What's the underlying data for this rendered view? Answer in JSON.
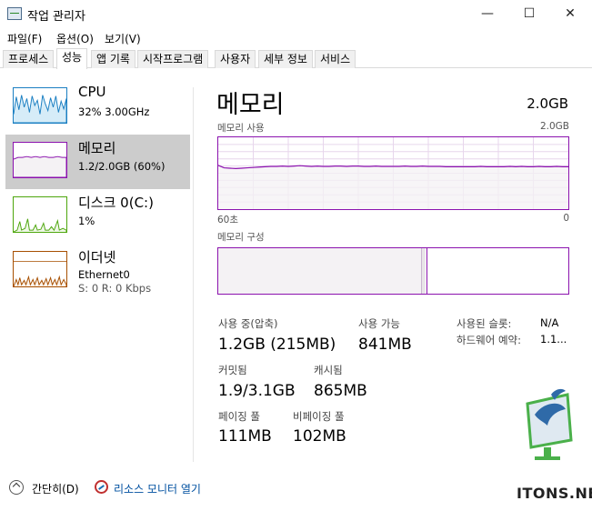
{
  "window": {
    "title": "작업 관리자",
    "controls": {
      "minimize": "—",
      "maximize": "☐",
      "close": "✕"
    }
  },
  "menu": {
    "items": [
      "파일(F)",
      "옵션(O)",
      "보기(V)"
    ]
  },
  "tabs": {
    "items": [
      "프로세스",
      "성능",
      "앱 기록",
      "시작프로그램",
      "사용자",
      "세부 정보",
      "서비스"
    ],
    "active": "성능"
  },
  "sidebar": {
    "items": [
      {
        "name": "CPU",
        "sub1": "32% 3.00GHz",
        "sub2": "",
        "color": "#1b7fc2",
        "fill": "#d6ecf8"
      },
      {
        "name": "메모리",
        "sub1": "1.2/2.0GB (60%)",
        "sub2": "",
        "color": "#8b12ae",
        "fill": "#f4f2f4",
        "selected": true
      },
      {
        "name": "디스크 0(C:)",
        "sub1": "1%",
        "sub2": "",
        "color": "#4da60c",
        "fill": "#eef7e6"
      },
      {
        "name": "이더넷",
        "sub1": "Ethernet0",
        "sub2": "S: 0 R: 0 Kbps",
        "color": "#a74f01",
        "fill": "#fcf3eb"
      }
    ]
  },
  "main": {
    "title": "메모리",
    "total": "2.0GB",
    "graph": {
      "label": "메모리 사용",
      "max_label": "2.0GB",
      "time_left": "60초",
      "time_right": "0",
      "color": "#8b12ae"
    },
    "composition": {
      "label": "메모리 구성",
      "in_use_fraction": 0.58,
      "modified_fraction": 0.012
    },
    "stats": {
      "in_use": {
        "label": "사용 중(압축)",
        "value": "1.2GB (215MB)"
      },
      "available": {
        "label": "사용 가능",
        "value": "841MB"
      },
      "slots": {
        "label": "사용된 슬롯:",
        "value": "N/A"
      },
      "hw_reserved": {
        "label": "하드웨어 예약:",
        "value": "1.1..."
      },
      "committed": {
        "label": "커밋됨",
        "value": "1.9/3.1GB"
      },
      "cached": {
        "label": "캐시됨",
        "value": "865MB"
      },
      "paged_pool": {
        "label": "페이징 풀",
        "value": "111MB"
      },
      "nonpaged_pool": {
        "label": "비페이징 풀",
        "value": "102MB"
      }
    }
  },
  "footer": {
    "collapse": "간단히(D)",
    "resource_monitor": "리소스 모니터 열기"
  },
  "chart_data": {
    "type": "area",
    "title": "메모리 사용",
    "xlabel": "",
    "ylabel": "",
    "x_range": [
      "60초",
      "0"
    ],
    "ylim": [
      0,
      2.0
    ],
    "y_unit": "GB",
    "series": [
      {
        "values": [
          1.22,
          1.15,
          1.14,
          1.13,
          1.14,
          1.15,
          1.16,
          1.17,
          1.18,
          1.19,
          1.19,
          1.2,
          1.19,
          1.2,
          1.21,
          1.2,
          1.19,
          1.2,
          1.19,
          1.19,
          1.2,
          1.2,
          1.19,
          1.2,
          1.2,
          1.19,
          1.19,
          1.2,
          1.19,
          1.19,
          1.19,
          1.19,
          1.2,
          1.19,
          1.19,
          1.2,
          1.19,
          1.19,
          1.19,
          1.18,
          1.18,
          1.18,
          1.18,
          1.18,
          1.18,
          1.19,
          1.18,
          1.18,
          1.18,
          1.18,
          1.19,
          1.18,
          1.19,
          1.18,
          1.18,
          1.19,
          1.18,
          1.18,
          1.19,
          1.18,
          1.18
        ]
      }
    ],
    "grid": true
  }
}
